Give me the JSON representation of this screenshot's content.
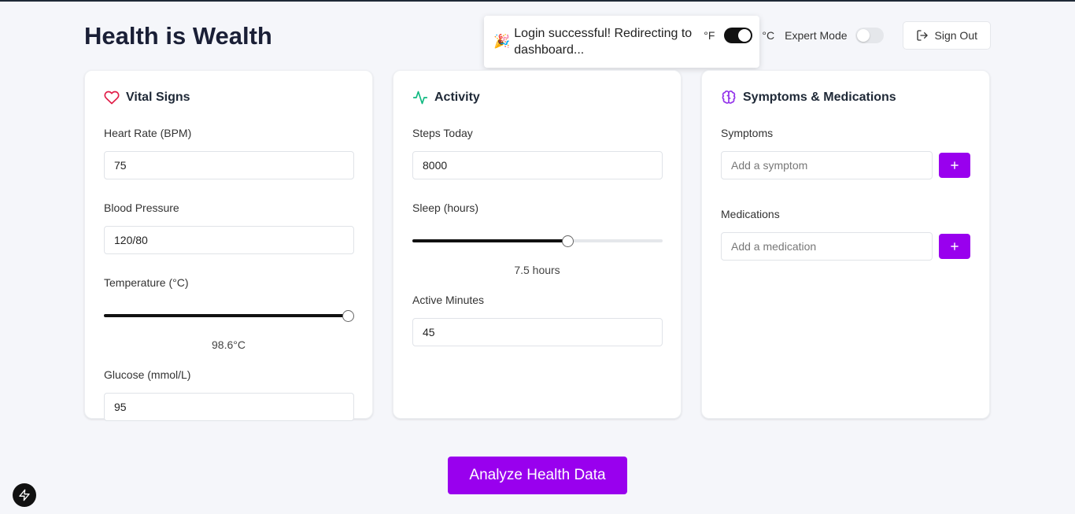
{
  "header": {
    "title": "Health is Wealth",
    "toast": {
      "icon": "party-popper-icon",
      "emoji": "🎉",
      "message": "Login successful! Redirecting to dashboard..."
    },
    "unit_f": "°F",
    "unit_c": "°C",
    "unit_toggle_on": true,
    "expert_label": "Expert Mode",
    "expert_on": false,
    "signout_label": "Sign Out"
  },
  "vitals": {
    "title": "Vital Signs",
    "icon": "heart-icon",
    "heart_rate_label": "Heart Rate (BPM)",
    "heart_rate_value": "75",
    "bp_label": "Blood Pressure",
    "bp_value": "120/80",
    "temp_label": "Temperature (°C)",
    "temp_fraction": 0.975,
    "temp_display": "98.6°C",
    "glucose_label": "Glucose (mmol/L)",
    "glucose_value": "95"
  },
  "activity": {
    "title": "Activity",
    "icon": "activity-icon",
    "steps_label": "Steps Today",
    "steps_value": "8000",
    "sleep_label": "Sleep (hours)",
    "sleep_fraction": 0.62,
    "sleep_display": "7.5 hours",
    "active_label": "Active Minutes",
    "active_value": "45"
  },
  "symptoms": {
    "title": "Symptoms & Medications",
    "icon": "brain-icon",
    "symptoms_label": "Symptoms",
    "symptom_placeholder": "Add a symptom",
    "medications_label": "Medications",
    "medication_placeholder": "Add a medication"
  },
  "analyze_label": "Analyze Health Data",
  "colors": {
    "accent": "#9900ee",
    "heart": "#e11d48",
    "activity": "#10b981",
    "brain": "#9333ea"
  }
}
